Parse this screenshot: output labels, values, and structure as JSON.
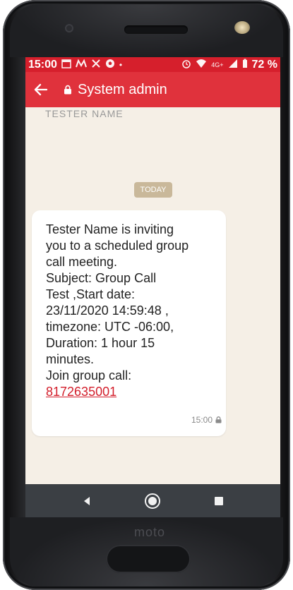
{
  "device": {
    "brand": "moto"
  },
  "statusbar": {
    "time": "15:00",
    "notification_icons": [
      "calendar-icon",
      "m-icon",
      "tools-icon",
      "soccer-icon"
    ],
    "dot": "•",
    "alarm_icon": "alarm-icon",
    "wifi_icon": "wifi-icon",
    "network": "4G+",
    "signal_icon": "signal-icon",
    "battery_icon": "battery-icon",
    "battery": "72 %"
  },
  "appbar": {
    "title": "System admin",
    "back_icon": "back-arrow-icon",
    "lock_icon": "lock-icon",
    "color": "#e0323c"
  },
  "chat": {
    "clipped_previous": "TESTER NAME",
    "date_chip": "TODAY",
    "message": {
      "lines": [
        "Tester Name is inviting",
        "you to a scheduled group",
        "call meeting.",
        "Subject: Group Call",
        "Test ,Start date:",
        "23/11/2020 14:59:48 ,",
        "timezone: UTC -06:00,",
        "Duration: 1 hour 15",
        "minutes.",
        "Join group call:"
      ],
      "link": "8172635001",
      "time": "15:00"
    }
  },
  "navbar": {
    "back": "◀",
    "home": "◉",
    "recents": "■"
  }
}
